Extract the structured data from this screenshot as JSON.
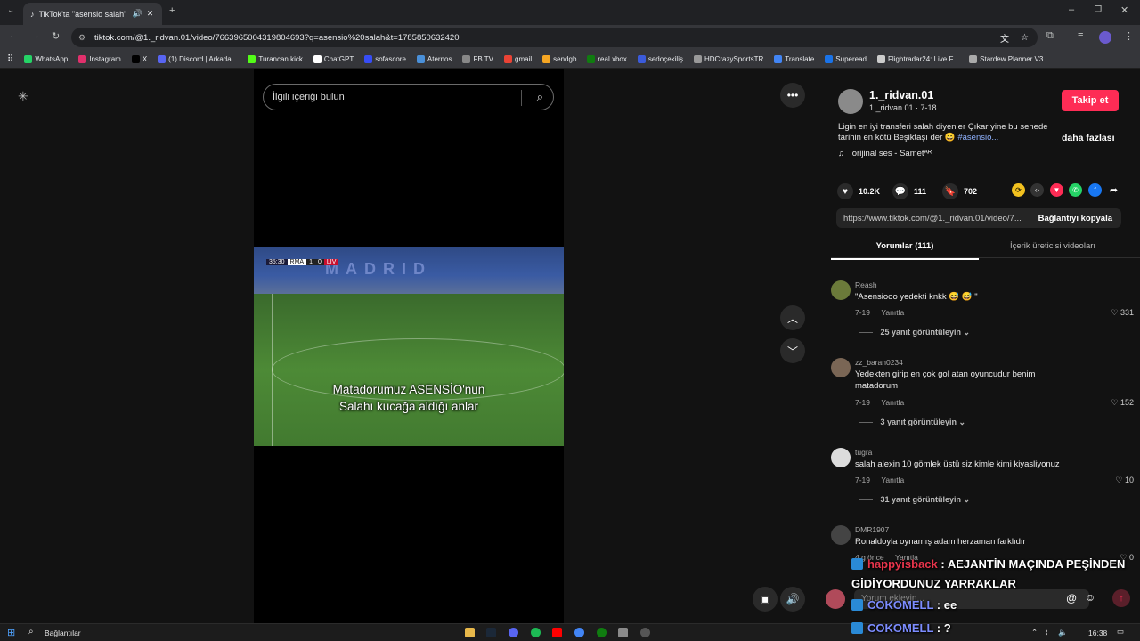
{
  "browser": {
    "tab_title": "TikTok'ta \"asensio salah\" bu",
    "url": "tiktok.com/@1._ridvan.01/video/7663965004319804693?q=asensio%20salah&t=1785850632420",
    "bookmarks": [
      {
        "label": "WhatsApp",
        "color": "#25d366"
      },
      {
        "label": "Instagram",
        "color": "#e1306c"
      },
      {
        "label": "X",
        "color": "#000000"
      },
      {
        "label": "(1) Discord | Arkada...",
        "color": "#5865f2"
      },
      {
        "label": "Turancan kick",
        "color": "#53fc18"
      },
      {
        "label": "ChatGPT",
        "color": "#ffffff"
      },
      {
        "label": "sofascore",
        "color": "#374df5"
      },
      {
        "label": "Aternos",
        "color": "#4a90d9"
      },
      {
        "label": "FB TV",
        "color": "#888888"
      },
      {
        "label": "gmail",
        "color": "#ea4335"
      },
      {
        "label": "sendgb",
        "color": "#f5a623"
      },
      {
        "label": "real xbox",
        "color": "#107c10"
      },
      {
        "label": "sedoçekiliş",
        "color": "#3b5bdb"
      },
      {
        "label": "HDCrazySportsTR",
        "color": "#999999"
      },
      {
        "label": "Translate",
        "color": "#4285f4"
      },
      {
        "label": "Superead",
        "color": "#1a73e8"
      },
      {
        "label": "Flightradar24: Live F...",
        "color": "#cccccc"
      },
      {
        "label": "Stardew Planner V3",
        "color": "#aaaaaa"
      }
    ]
  },
  "search": {
    "placeholder": "İlgili içeriği bulun"
  },
  "video": {
    "scoreboard": {
      "time": "35:30",
      "home": "RMA",
      "home_score": "1",
      "away_score": "0",
      "away": "LIV"
    },
    "banner": "MADRID",
    "caption_line1": "Matadorumuz ASENSİO'nun",
    "caption_line2": "Salahı kucağa aldığı anlar"
  },
  "author": {
    "display_name": "1._ridvan.01",
    "sub": "1._ridvan.01 · 7-18",
    "follow_label": "Takip et",
    "description": "Ligin en iyi transferi salah diyenler Çıkar yine bu senede tarihin en kötü Beşiktaşı der",
    "hashtag": "#asensio...",
    "more_label": "daha fazlası",
    "music": "orijinal ses - Sametᴬᴿ"
  },
  "stats": {
    "likes": "10.2K",
    "comments": "111",
    "saves": "702"
  },
  "share": {
    "link": "https://www.tiktok.com/@1._ridvan.01/video/7...",
    "copy_label": "Bağlantıyı kopyala"
  },
  "tabs": {
    "comments": "Yorumlar (111)",
    "creator_videos": "İçerik üreticisi videoları"
  },
  "comments": [
    {
      "user": "Reash",
      "text": "\"Asensiooo yedekti knkk 😅 😅 \"",
      "date": "7-19",
      "reply": "Yanıtla",
      "likes": "331",
      "more": "25 yanıt görüntüleyin"
    },
    {
      "user": "zz_baran0234",
      "text": "Yedekten girip en çok gol atan oyuncudur benim matadorum",
      "date": "7-19",
      "reply": "Yanıtla",
      "likes": "152",
      "more": "3 yanıt görüntüleyin"
    },
    {
      "user": "tugra",
      "text": "salah alexin 10 gömlek üstü siz kimle kimi kiyasliyonuz",
      "date": "7-19",
      "reply": "Yanıtla",
      "likes": "10",
      "more": "31 yanıt görüntüleyin"
    },
    {
      "user": "DMR1907",
      "text": "Ronaldoyla oynamış adam herzaman farklıdır",
      "date": "4 g önce",
      "reply": "Yanıtla",
      "likes": "0"
    }
  ],
  "comment_input": {
    "placeholder": "Yorum ekleyin..."
  },
  "stream_chat": [
    {
      "user": "happyisback",
      "user_color": "#e8354c",
      "message": ": AEJANTİN MAÇINDA PEŞİNDEN",
      "continuation": "GİDİYORDUNUZ YARRAKLAR"
    },
    {
      "user": "COKOMELL",
      "user_color": "#7c8cff",
      "message": ": ee"
    },
    {
      "user": "COKOMELL",
      "user_color": "#7c8cff",
      "message": ": ?"
    }
  ],
  "taskbar": {
    "search_label": "Bağlantılar",
    "clock": "16:38"
  }
}
